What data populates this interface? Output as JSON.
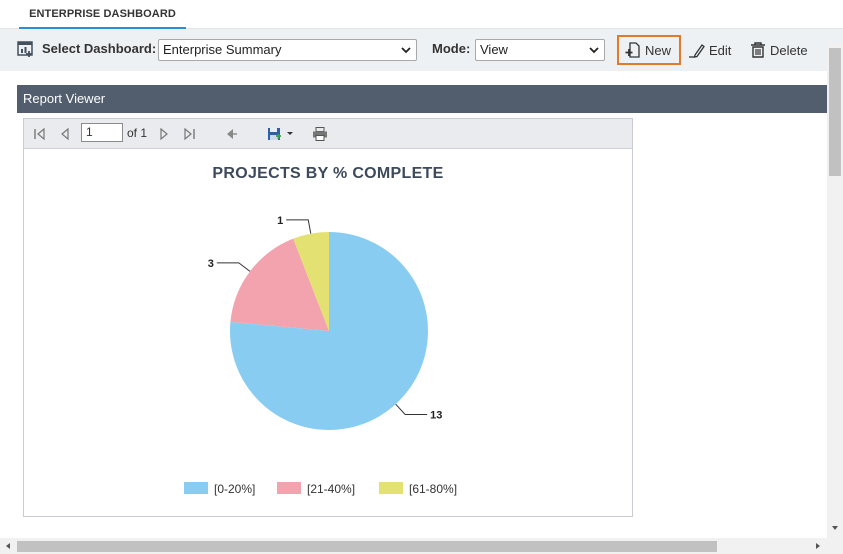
{
  "tab": {
    "label": "ENTERPRISE DASHBOARD"
  },
  "toolbar": {
    "select_dashboard_label": "Select Dashboard:",
    "dashboard_value": "Enterprise Summary",
    "mode_label": "Mode:",
    "mode_value": "View",
    "new_label": "New",
    "edit_label": "Edit",
    "delete_label": "Delete"
  },
  "report_viewer": {
    "title": "Report Viewer",
    "page_value": "1",
    "of_label": "of 1"
  },
  "chart_data": {
    "type": "pie",
    "title": "PROJECTS BY % COMPLETE",
    "categories": [
      "[0-20%]",
      "[21-40%]",
      "[61-80%]"
    ],
    "values": [
      13,
      3,
      1
    ],
    "colors": [
      "#88cdf1",
      "#f3a3ae",
      "#e3e172"
    ],
    "data_labels": [
      "13",
      "3",
      "1"
    ],
    "legend_position": "bottom"
  },
  "colors": {
    "accent_tab": "#2b8fd6",
    "highlight": "#e07b2a",
    "header_bg": "#525e6e"
  }
}
